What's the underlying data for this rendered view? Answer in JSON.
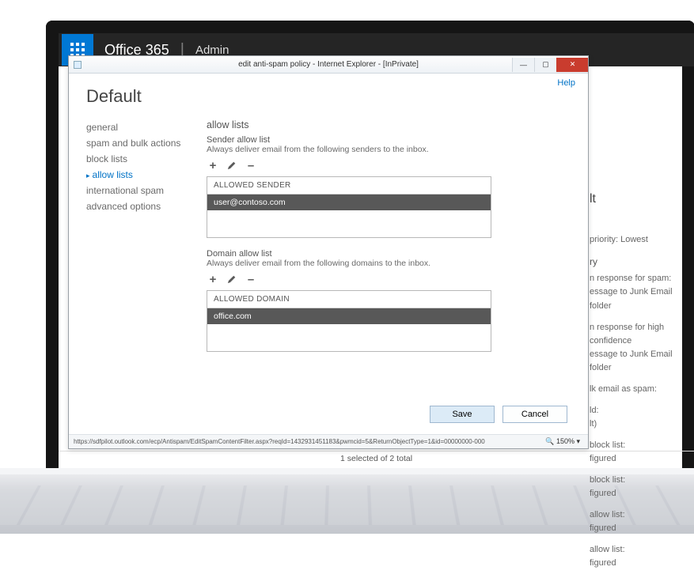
{
  "browser": {
    "title": "edit anti-spam policy - Internet Explorer - [InPrivate]",
    "status_url": "https://sdfpilot.outlook.com/ecp/Antispam/EditSpamContentFilter.aspx?reqId=1432931451183&pwmcid=5&ReturnObjectType=1&id=00000000-0000-0000-0000-000000000000",
    "zoom": "150%"
  },
  "o365": {
    "brand": "Office 365",
    "section": "Admin"
  },
  "help_label": "Help",
  "page_title": "Default",
  "nav": [
    {
      "label": "general",
      "active": false
    },
    {
      "label": "spam and bulk actions",
      "active": false
    },
    {
      "label": "block lists",
      "active": false
    },
    {
      "label": "allow lists",
      "active": true
    },
    {
      "label": "international spam",
      "active": false
    },
    {
      "label": "advanced options",
      "active": false
    }
  ],
  "main": {
    "heading": "allow lists",
    "sender": {
      "label": "Sender allow list",
      "desc": "Always deliver email from the following senders to the inbox.",
      "column": "ALLOWED SENDER",
      "rows": [
        "user@contoso.com"
      ]
    },
    "domain": {
      "label": "Domain allow list",
      "desc": "Always deliver email from the following domains to the inbox.",
      "column": "ALLOWED DOMAIN",
      "rows": [
        "office.com"
      ]
    }
  },
  "buttons": {
    "save": "Save",
    "cancel": "Cancel"
  },
  "bg_footer": "1 selected of 2 total",
  "bg_panel": {
    "title_tail": "lt",
    "priority": "priority: Lowest",
    "summary_hd": "ry",
    "l1a": "n response for spam:",
    "l1b": "essage to Junk Email folder",
    "l2a": "n response for high confidence",
    "l2b": "essage to Junk Email folder",
    "l3": "lk email as spam:",
    "l4a": "ld:",
    "l4b": "lt)",
    "l5a": "block list:",
    "l5b": "figured",
    "l6a": "block list:",
    "l6b": "figured",
    "l7a": "allow list:",
    "l7b": "figured",
    "l8a": "allow list:",
    "l8b": "figured"
  }
}
